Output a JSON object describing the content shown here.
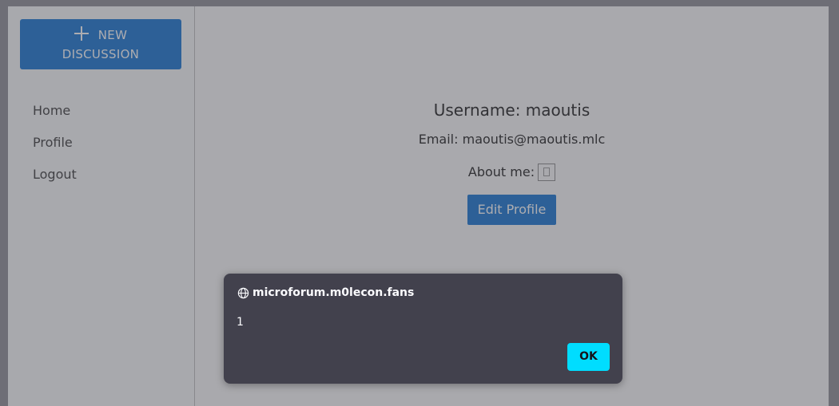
{
  "sidebar": {
    "new_button": {
      "line1": "NEW",
      "line2": "DISCUSSION",
      "icon": "plus-icon"
    },
    "items": [
      {
        "label": "Home"
      },
      {
        "label": "Profile"
      },
      {
        "label": "Logout"
      }
    ]
  },
  "profile": {
    "username": "Username: maoutis",
    "email": "Email: maoutis@maoutis.mlc",
    "about_label": "About me:",
    "about_icon": "broken-image-icon",
    "edit_button": "Edit Profile"
  },
  "alert": {
    "origin": "microforum.m0lecon.fans",
    "origin_icon": "globe-icon",
    "message": "1",
    "ok_label": "OK"
  },
  "colors": {
    "primary": "#1976d2",
    "dialog_bg": "#42414d",
    "ok_button": "#00ddff"
  }
}
